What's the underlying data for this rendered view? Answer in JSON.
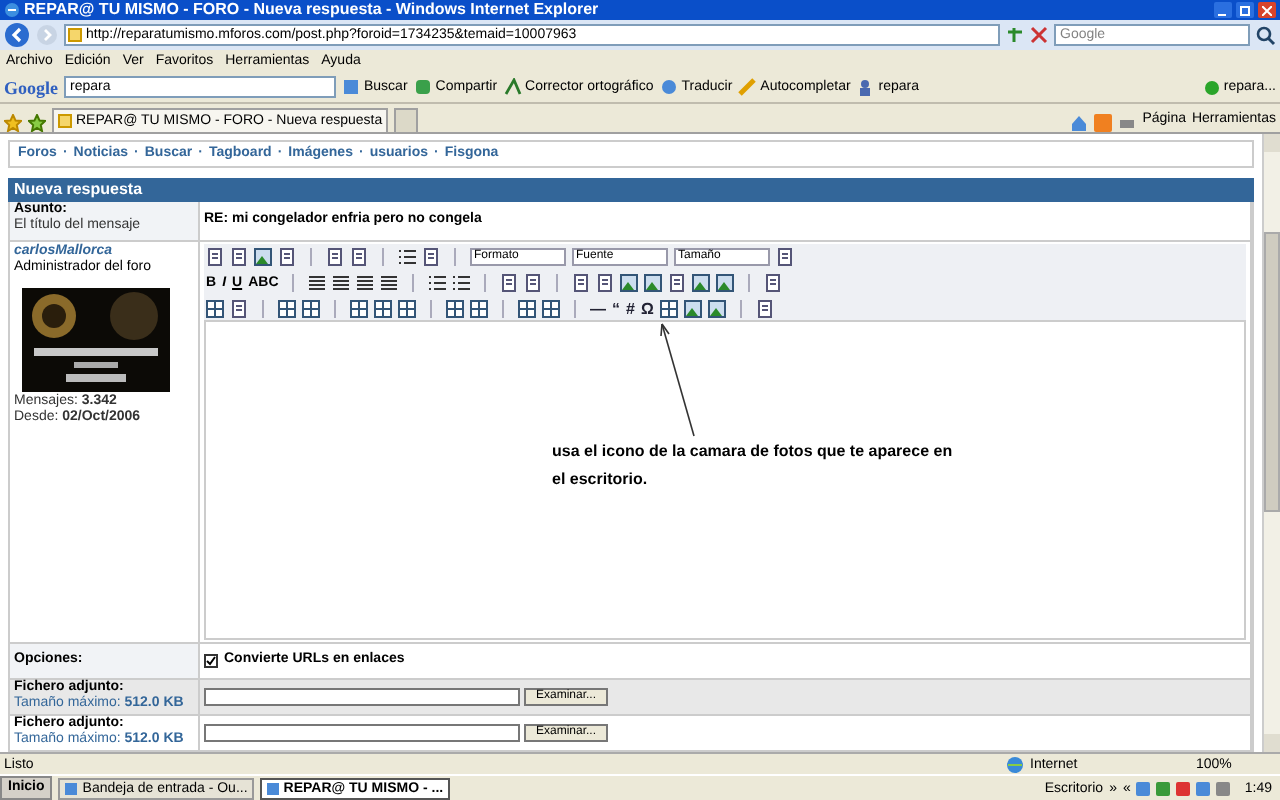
{
  "window": {
    "title": "REPAR@ TU MISMO - FORO - Nueva respuesta - Windows Internet Explorer"
  },
  "address": {
    "url": "http://reparatumismo.mforos.com/post.php?foroid=1734235&temaid=10007963",
    "search_placeholder": "Google"
  },
  "menu": [
    "Archivo",
    "Edición",
    "Ver",
    "Favoritos",
    "Herramientas",
    "Ayuda"
  ],
  "google_toolbar": {
    "logo": "Google",
    "query": "repara",
    "items": [
      "Buscar",
      "Compartir",
      "Corrector ortográfico",
      "Traducir",
      "Autocompletar",
      "repara"
    ],
    "account": "repara..."
  },
  "tabs": [
    {
      "label": "REPAR@ TU MISMO - FORO - Nueva respuesta",
      "selected": true
    }
  ],
  "command_bar": [
    "Página",
    "Herramientas"
  ],
  "nav": {
    "separator": "·",
    "links": [
      "Foros",
      "Noticias",
      "Buscar",
      "Tagboard",
      "Imágenes",
      "usuarios",
      "Fisgona"
    ]
  },
  "form": {
    "header": "Nueva respuesta",
    "subject": {
      "label": "Asunto:",
      "hint": "El título del mensaje",
      "value": "RE: mi congelador enfria pero no congela"
    },
    "author": {
      "name": "carlosMallorca",
      "role": "Administrador del foro",
      "posts": "Mensajes: **3.342**",
      "since": "Desde: **02/Oct/2006**"
    },
    "editor": {
      "dropdowns": [
        "Formato",
        "Fuente",
        "Tamaño"
      ],
      "format_buttons": [
        "B",
        "I",
        "U",
        "ABC"
      ],
      "symbols": [
        "—",
        "“",
        "#",
        "Ω"
      ],
      "message": [
        "usa el icono de la camara de fotos que te aparece en",
        "el escritorio."
      ]
    },
    "options": {
      "label": "Opciones:",
      "checkbox": {
        "label": "Convierte URLs en enlaces",
        "checked": true
      }
    },
    "attachments": [
      {
        "label": "Fichero adjunto:",
        "limit": "Tamaño máximo: **512.0 KB**",
        "button": "Examinar..."
      },
      {
        "label": "Fichero adjunto:",
        "limit": "Tamaño máximo: **512.0 KB**",
        "button": "Examinar..."
      }
    ]
  },
  "status_bar": {
    "text": "Listo",
    "zone": "Internet",
    "zoom": "100%"
  },
  "taskbar": {
    "start": "Inicio",
    "items": [
      {
        "label": "Bandeja de entrada - Ou...",
        "selected": false
      },
      {
        "label": "REPAR@ TU MISMO - ...",
        "selected": true
      }
    ],
    "toolbar": "Escritorio",
    "more": "»",
    "tray_expand": "«",
    "clock": "1:49"
  }
}
